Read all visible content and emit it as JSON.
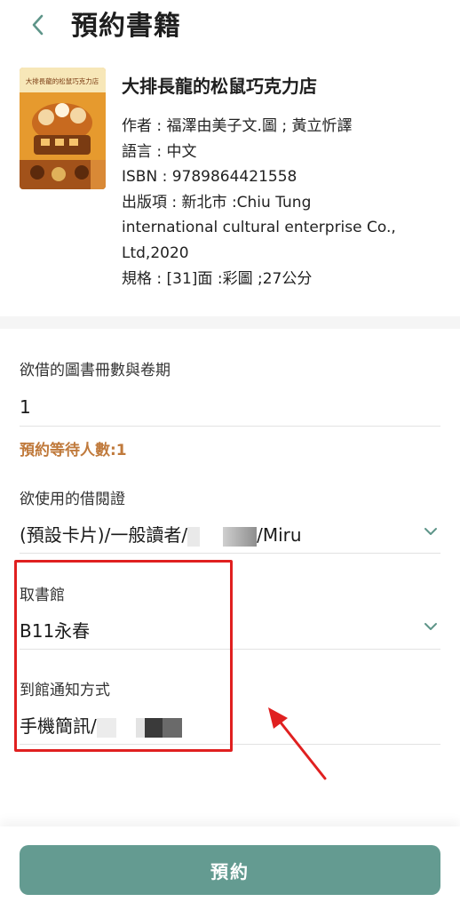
{
  "header": {
    "title": "預約書籍"
  },
  "book": {
    "title": "大排長龍的松鼠巧克力店",
    "cover_text": "大排長龍的松鼠巧克力店",
    "meta": [
      "作者 : 福澤由美子文.圖 ; 黃立忻譯",
      "語言 : 中文",
      "ISBN : 9789864421558",
      "出版項 : 新北市 :Chiu Tung",
      "international cultural enterprise Co.,",
      "Ltd,2020",
      "規格 : [31]面 :彩圖 ;27公分"
    ]
  },
  "form": {
    "copies_label": "欲借的圖書冊數與卷期",
    "copies_value": "1",
    "wait_text": "預約等待人數:1",
    "card_label": "欲使用的借閱證",
    "card_value_prefix": "(預設卡片)/一般讀者/",
    "card_value_suffix": "/Miru",
    "pickup_label": "取書館",
    "pickup_value": "B11永春",
    "notify_label": "到館通知方式",
    "notify_value_prefix": "手機簡訊/"
  },
  "actions": {
    "reserve_label": "預約"
  },
  "colors": {
    "accent": "#649b91",
    "wait_text": "#c07a3c",
    "highlight_box": "#e02020",
    "annotation_arrow": "#e02020"
  },
  "icons": {
    "back": "chevron-left-icon",
    "dropdown": "chevron-down-icon"
  }
}
